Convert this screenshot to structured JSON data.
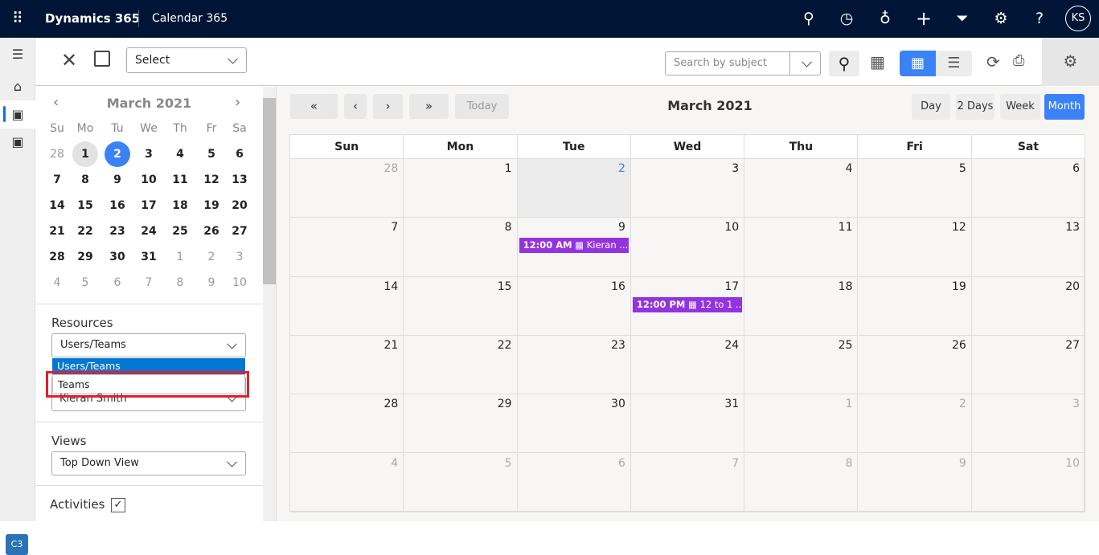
{
  "topbar": {
    "brand": "Dynamics 365",
    "app": "Calendar 365",
    "avatar": "KS",
    "icons": [
      "waffle-icon",
      "search-icon",
      "assistant-icon",
      "lightbulb-icon",
      "plus-icon",
      "filter-icon",
      "gear-icon",
      "help-icon"
    ]
  },
  "rail": {
    "badge": "C3"
  },
  "toolbar": {
    "select_value": "Select",
    "search_placeholder": "Search by subject"
  },
  "mini": {
    "title": "March 2021",
    "weekdays": [
      "Su",
      "Mo",
      "Tu",
      "We",
      "Th",
      "Fr",
      "Sa"
    ],
    "weeks": [
      [
        "28",
        "1",
        "2",
        "3",
        "4",
        "5",
        "6"
      ],
      [
        "7",
        "8",
        "9",
        "10",
        "11",
        "12",
        "13"
      ],
      [
        "14",
        "15",
        "16",
        "17",
        "18",
        "19",
        "20"
      ],
      [
        "21",
        "22",
        "23",
        "24",
        "25",
        "26",
        "27"
      ],
      [
        "28",
        "29",
        "30",
        "31",
        "1",
        "2",
        "3"
      ],
      [
        "4",
        "5",
        "6",
        "7",
        "8",
        "9",
        "10"
      ]
    ],
    "selected": "2",
    "highlighted": "1"
  },
  "resources": {
    "label": "Resources",
    "value": "Users/Teams",
    "options": [
      "Users/Teams",
      "Teams"
    ],
    "second_value": "Kieran Smith"
  },
  "views": {
    "label": "Views",
    "value": "Top Down View"
  },
  "activities": {
    "label": "Activities",
    "checked": true
  },
  "calendar": {
    "title": "March 2021",
    "today": "Today",
    "views": [
      "Day",
      "2 Days",
      "Week",
      "Month"
    ],
    "active_view": "Month",
    "weekdays": [
      "Sun",
      "Mon",
      "Tue",
      "Wed",
      "Thu",
      "Fri",
      "Sat"
    ],
    "weeks": [
      [
        "28",
        "1",
        "2",
        "3",
        "4",
        "5",
        "6"
      ],
      [
        "7",
        "8",
        "9",
        "10",
        "11",
        "12",
        "13"
      ],
      [
        "14",
        "15",
        "16",
        "17",
        "18",
        "19",
        "20"
      ],
      [
        "21",
        "22",
        "23",
        "24",
        "25",
        "26",
        "27"
      ],
      [
        "28",
        "29",
        "30",
        "31",
        "1",
        "2",
        "3"
      ],
      [
        "4",
        "5",
        "6",
        "7",
        "8",
        "9",
        "10"
      ]
    ],
    "events": [
      {
        "week": 1,
        "day": 2,
        "time": "12:00 AM",
        "title": "Kieran ..."
      },
      {
        "week": 2,
        "day": 3,
        "time": "12:00 PM",
        "title": "12 to 1 ..."
      }
    ],
    "event_color": "#9333e0",
    "accent": "#3b82f6"
  }
}
